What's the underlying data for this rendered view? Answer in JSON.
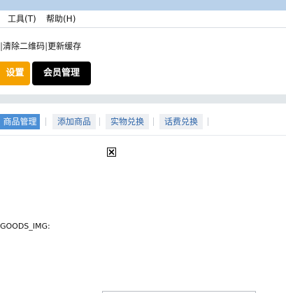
{
  "menubar": {
    "items": [
      {
        "label": "工具(T)"
      },
      {
        "label": "帮助(H)"
      }
    ]
  },
  "actions": {
    "clear_qrcode": "清除二维码",
    "update_cache": "更新缓存",
    "separator": "|"
  },
  "buttons": {
    "settings": "设置",
    "member_management": "会员管理"
  },
  "tabs": [
    {
      "label": "商品管理",
      "active": true
    },
    {
      "label": "添加商品",
      "active": false
    },
    {
      "label": "实物兑换",
      "active": false
    },
    {
      "label": "话费兑换",
      "active": false
    }
  ],
  "content": {
    "goods_img_label": "GOODS_IMG:"
  },
  "colors": {
    "titlebar": "#b9d1ea",
    "settings_button": "#f5a200",
    "member_button": "#000000",
    "active_tab": "#4b8fd6",
    "tab_text": "#2b63a8"
  }
}
